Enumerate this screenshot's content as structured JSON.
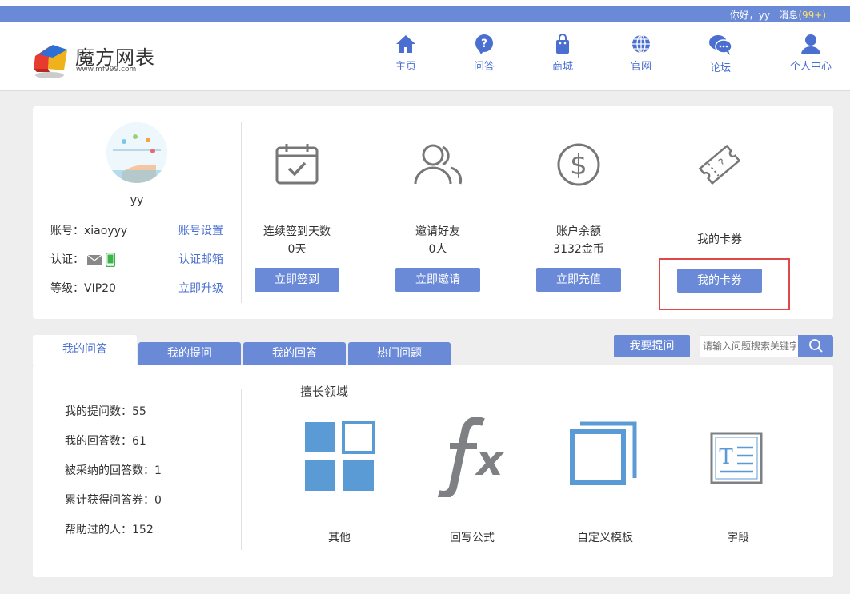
{
  "topbar": {
    "greeting": "你好，yy",
    "messages_label": "消息",
    "messages_count": "(99+)"
  },
  "logo": {
    "name": "魔方网表",
    "site": "www.mf999.com"
  },
  "nav": [
    {
      "label": "主页",
      "icon": "home-icon"
    },
    {
      "label": "问答",
      "icon": "question-icon"
    },
    {
      "label": "商城",
      "icon": "shopping-bag-icon"
    },
    {
      "label": "官网",
      "icon": "globe-icon"
    },
    {
      "label": "论坛",
      "icon": "chat-icon"
    },
    {
      "label": "个人中心",
      "icon": "user-icon"
    }
  ],
  "profile": {
    "username": "yy",
    "account_label": "账号：xiaoyyy",
    "account_settings": "账号设置",
    "verify_label": "认证：",
    "verify_email": "认证邮箱",
    "level_label": "等级：VIP20",
    "upgrade": "立即升级"
  },
  "stats": [
    {
      "title": "连续签到天数",
      "value": "0天",
      "button": "立即签到",
      "icon": "calendar-check-icon"
    },
    {
      "title": "邀请好友",
      "value": "0人",
      "button": "立即邀请",
      "icon": "users-icon"
    },
    {
      "title": "账户余额",
      "value": "3132金币",
      "button": "立即充值",
      "icon": "dollar-icon"
    },
    {
      "title": "我的卡券",
      "value": "",
      "button": "我的卡券",
      "icon": "ticket-icon"
    }
  ],
  "tabs": [
    "我的问答",
    "我的提问",
    "我的回答",
    "热门问题"
  ],
  "ask_button": "我要提问",
  "search": {
    "placeholder": "请输入问题搜索关键字"
  },
  "qa_stats": [
    "我的提问数：55",
    "我的回答数：61",
    "被采纳的回答数：1",
    "累计获得问答券：0",
    "帮助过的人：152"
  ],
  "fields": {
    "title": "擅长领域",
    "items": [
      {
        "label": "其他",
        "icon": "grid-icon"
      },
      {
        "label": "回写公式",
        "icon": "formula-fx-icon"
      },
      {
        "label": "自定义模板",
        "icon": "template-icon"
      },
      {
        "label": "字段",
        "icon": "text-field-icon"
      }
    ]
  },
  "colors": {
    "accent": "#6a8ad8",
    "link": "#4a6fd0",
    "highlight": "#e04848",
    "field_icon": "#5b9bd5"
  }
}
